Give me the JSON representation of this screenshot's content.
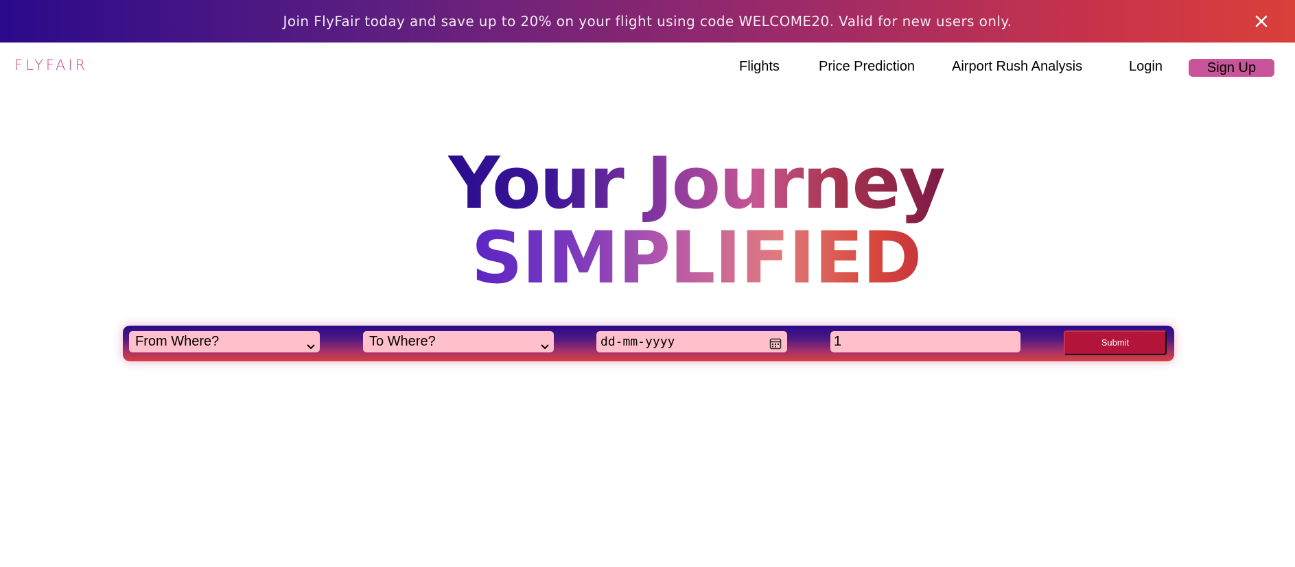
{
  "promo": {
    "text": "Join FlyFair today and save up to 20% on your flight using code WELCOME20. Valid for new users only.",
    "close_icon": "close-icon"
  },
  "header": {
    "logo": "FLYFAIR",
    "nav": {
      "flights": "Flights",
      "price_prediction": "Price Prediction",
      "airport_rush": "Airport Rush Analysis",
      "login": "Login",
      "signup": "Sign Up"
    }
  },
  "hero": {
    "line1": "Your Journey",
    "line2": "SIMPLIFIED"
  },
  "search": {
    "from_value": "From Where?",
    "to_value": "To Where?",
    "date_placeholder": "dd-mm-yyyy",
    "passengers_value": "1",
    "submit_label": "Submit"
  },
  "colors": {
    "brand_pink": "#c85599",
    "submit_red": "#b3153a",
    "field_bg": "#ffbfcb",
    "banner_start": "#2a0a8a",
    "banner_end": "#d9403a"
  }
}
